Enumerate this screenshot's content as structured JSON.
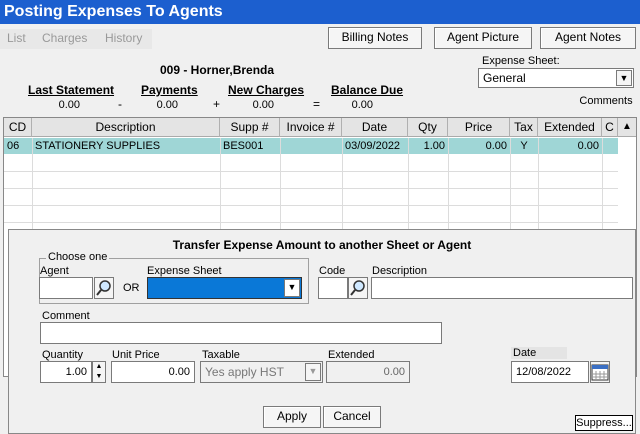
{
  "window": {
    "title": "Posting Expenses To Agents"
  },
  "menu": {
    "list": "List",
    "charges": "Charges",
    "history": "History"
  },
  "toolbar": {
    "billing_notes": "Billing Notes",
    "agent_picture": "Agent Picture",
    "agent_notes": "Agent Notes",
    "comments": "Comments"
  },
  "agent": {
    "name": "009 - Horner,Brenda"
  },
  "summary": {
    "last_statement_label": "Last Statement",
    "last_statement": "0.00",
    "payments_label": "Payments",
    "payments": "0.00",
    "new_charges_label": "New Charges",
    "new_charges": "0.00",
    "balance_due_label": "Balance Due",
    "balance_due": "0.00",
    "minus": "-",
    "plus": "+",
    "equals": "="
  },
  "expense_sheet": {
    "label": "Expense Sheet:",
    "value": "General"
  },
  "grid": {
    "columns": [
      "CD",
      "Description",
      "Supp #",
      "Invoice #",
      "Date",
      "Qty",
      "Price",
      "Tax",
      "Extended",
      "C"
    ],
    "rows": [
      {
        "cd": "06",
        "description": "STATIONERY SUPPLIES",
        "supp": "BES001",
        "invoice": "",
        "date": "03/09/2022",
        "qty": "1.00",
        "price": "0.00",
        "tax": "Y",
        "extended": "0.00"
      }
    ]
  },
  "dialog": {
    "title": "Transfer Expense Amount to another Sheet or Agent",
    "choose_one": "Choose one",
    "agent_label": "Agent",
    "or": "OR",
    "expense_sheet_label": "Expense Sheet",
    "code_label": "Code",
    "description_label": "Description",
    "comment_label": "Comment",
    "quantity_label": "Quantity",
    "quantity": "1.00",
    "unit_price_label": "Unit Price",
    "unit_price": "0.00",
    "taxable_label": "Taxable",
    "taxable": "Yes apply HST",
    "extended_label": "Extended",
    "extended": "0.00",
    "date_label": "Date",
    "date": "12/08/2022",
    "apply": "Apply",
    "cancel": "Cancel"
  },
  "suppress": "Suppress..."
}
